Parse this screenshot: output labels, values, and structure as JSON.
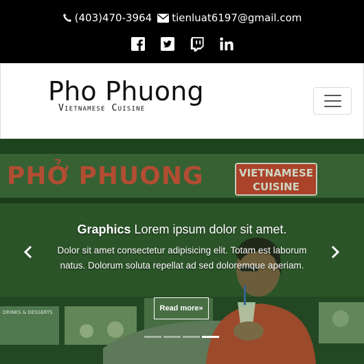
{
  "topbar": {
    "phone": "(403)470-3964",
    "email": "tienluat6197@gmail.com",
    "icons": {
      "phone": "phone-icon",
      "email": "envelope-icon",
      "social": [
        "facebook-icon",
        "twitter-icon",
        "twitch-icon",
        "linkedin-icon"
      ]
    }
  },
  "brand": {
    "title": "Pho Phuong",
    "subtitle": "Vietnamese Cuisine"
  },
  "navbar": {
    "toggler_icon": "hamburger-menu-icon"
  },
  "carousel": {
    "sign_name": "PHỞ PHUONG",
    "sign_badge_line1": "VIETNAMESE",
    "sign_badge_line2": "CUISINE",
    "sign_small": "DRINKS & DESSERTS",
    "caption": {
      "heading_bold": "Graphics",
      "heading_rest": " Lorem ipsum dolor sit amet.",
      "text": "Dolor sit amet consectetur adipisicing elit. Totam est laborum natus. Dolorum soluta repellat ad sed doloremque aperiam.",
      "button": "Read more»"
    },
    "indicators": {
      "count": 4,
      "active_index": 3
    },
    "controls": {
      "prev": "chevron-left-icon",
      "next": "chevron-right-icon"
    }
  },
  "colors": {
    "topbar_bg": "#000000",
    "sign_red": "#c8392b",
    "scene_green": "#2f5a2c"
  }
}
